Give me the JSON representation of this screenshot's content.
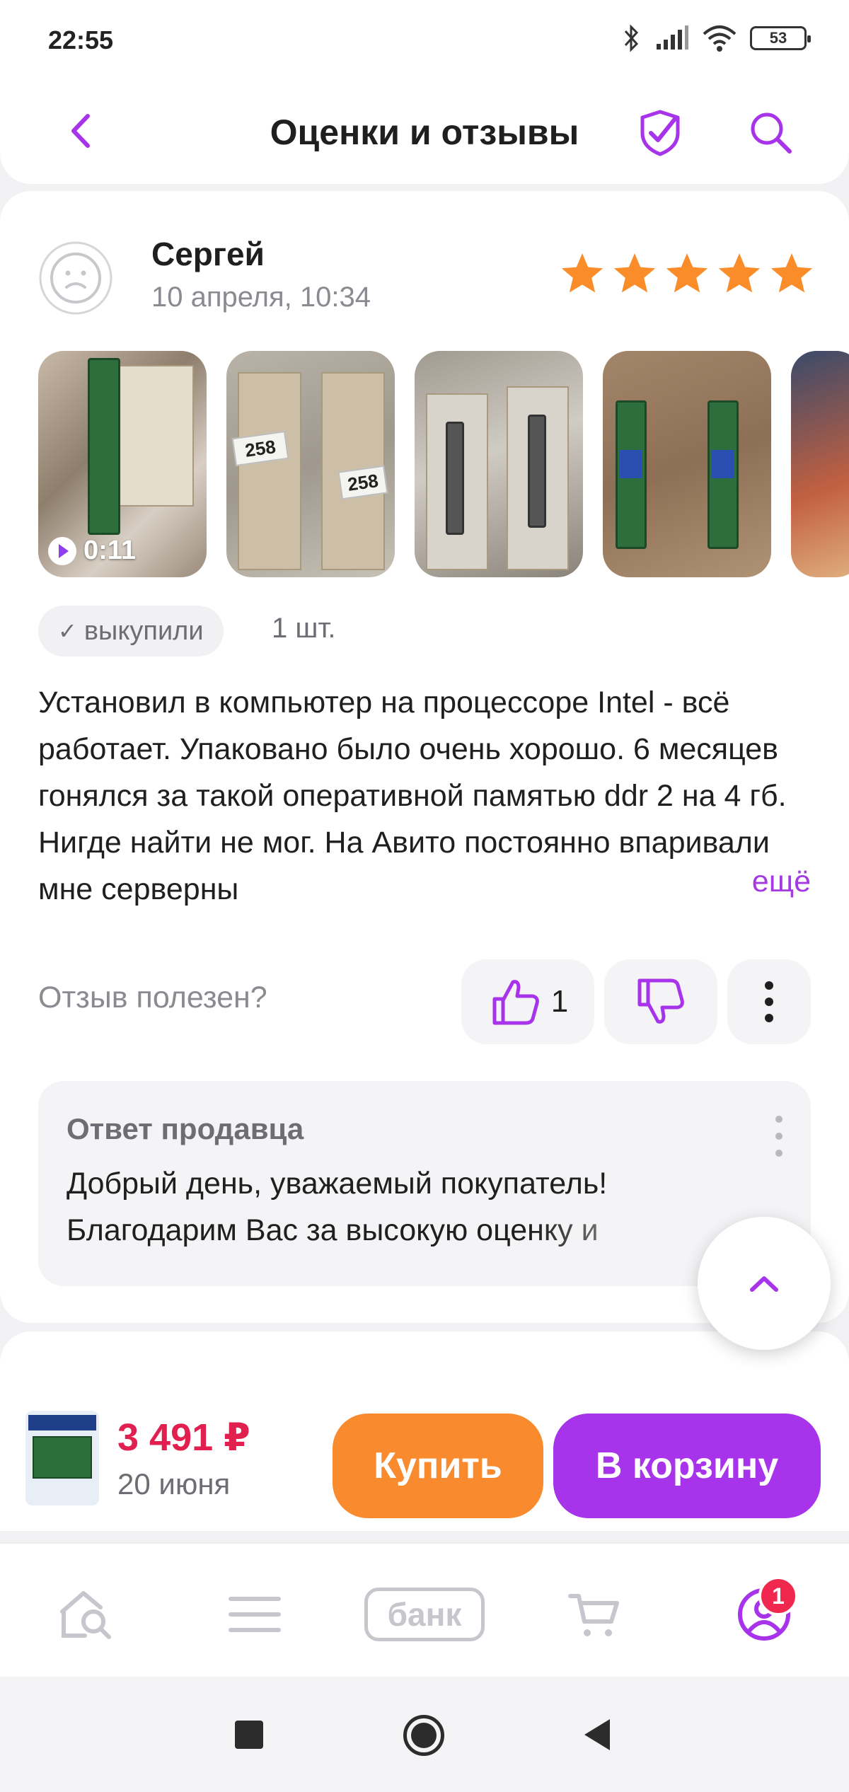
{
  "status_bar": {
    "time": "22:55",
    "battery": "53"
  },
  "header": {
    "title": "Оценки и отзывы"
  },
  "review": {
    "author": "Сергей",
    "date": "10 апреля, 10:34",
    "rating": 5,
    "video_duration": "0:11",
    "photo_labels": [
      "258",
      "258"
    ],
    "bought_badge": "выкупили",
    "quantity": "1 шт.",
    "text": "Установил в компьютер на процессоре Intel - всё работает. Упаковано было очень хорошо. 6 месяцев гонялся за такой оперативной памятью ddr 2 на 4 гб. Нигде найти не мог. На Авито постоянно впаривали мне серверны",
    "more_link": "ещё",
    "helpful_question": "Отзыв полезен?",
    "likes": "1"
  },
  "seller_reply": {
    "title": "Ответ продавца",
    "text": "Добрый день, уважаемый покупатель! Благодарим Вас за высокую оценку и"
  },
  "buy_bar": {
    "price": "3 491 ₽",
    "delivery": "20 июня",
    "buy_label": "Купить",
    "cart_label": "В корзину"
  },
  "tab_bar": {
    "bank_label": "банк",
    "profile_badge": "1"
  },
  "colors": {
    "accent": "#a734ea",
    "buy": "#f98b2e",
    "price": "#e2204f",
    "star": "#fb8c2a"
  }
}
